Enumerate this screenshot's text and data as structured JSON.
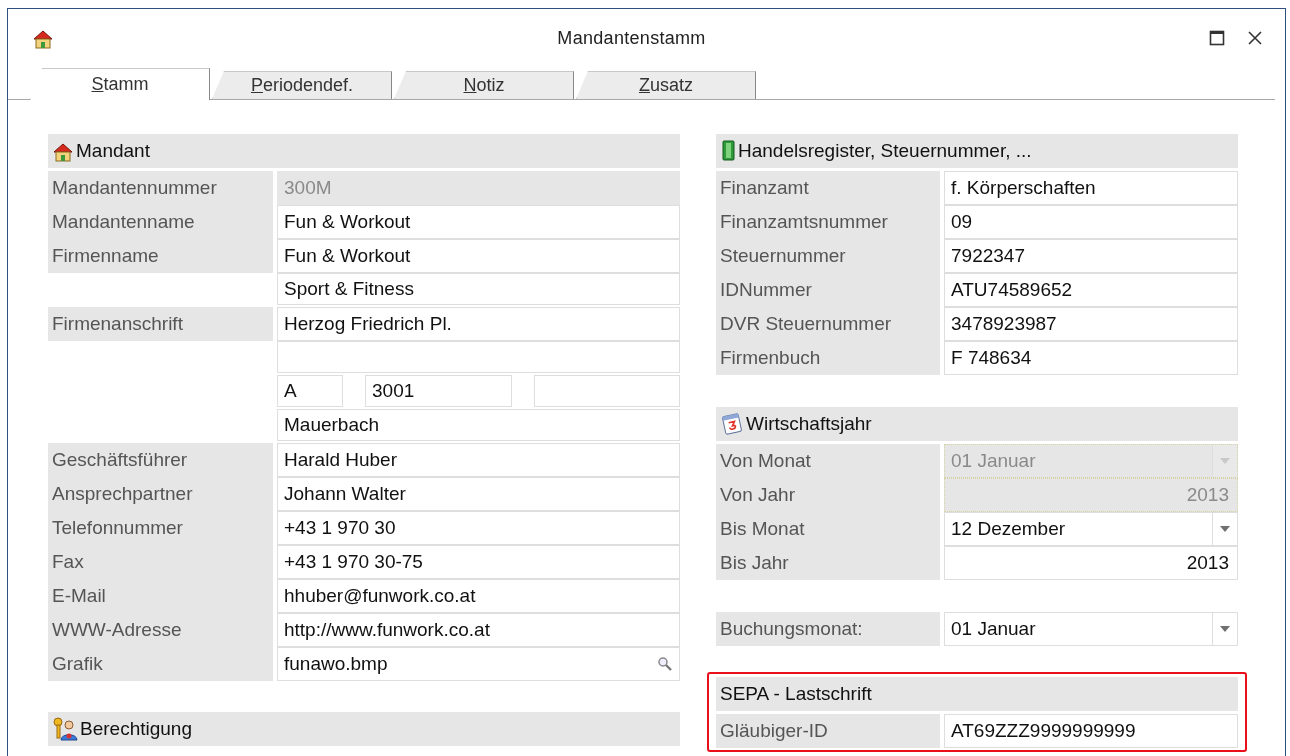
{
  "window": {
    "title": "Mandantenstamm"
  },
  "tabs": [
    {
      "label": "Stamm",
      "selected": true
    },
    {
      "label": "Periodendef.",
      "selected": false
    },
    {
      "label": "Notiz",
      "selected": false
    },
    {
      "label": "Zusatz",
      "selected": false
    }
  ],
  "columns": [
    {
      "sections": [
        {
          "title": "Mandant",
          "rows": [
            {
              "label": "Mandantennummer",
              "kind": "text",
              "value": "300M",
              "disabled": true
            },
            {
              "label": "Mandantenname",
              "kind": "text",
              "value": "Fun & Workout",
              "disabled": false
            },
            {
              "label": "Firmenname",
              "kind": "text",
              "value": "Fun & Workout",
              "disabled": false
            },
            {
              "kind": "text",
              "value": "Sport & Fitness",
              "disabled": false
            },
            {
              "label": "Firmenanschrift",
              "kind": "text",
              "value": "Herzog Friedrich Pl.",
              "disabled": false
            },
            {
              "kind": "text",
              "disabled": false
            },
            {
              "kind": "split",
              "parts": [
                {
                  "kind": "text",
                  "value": "A"
                },
                {
                  "kind": "text",
                  "value": "3001"
                },
                {
                  "kind": "text"
                }
              ],
              "disabled": false
            },
            {
              "kind": "text",
              "value": "Mauerbach",
              "disabled": false
            },
            {
              "label": "Geschäftsführer",
              "kind": "text",
              "value": "Harald Huber",
              "disabled": false
            },
            {
              "label": "Ansprechpartner",
              "kind": "text",
              "value": "Johann Walter",
              "disabled": false
            },
            {
              "label": "Telefonnummer",
              "kind": "text",
              "value": "+43 1 970 30",
              "disabled": false
            },
            {
              "label": "Fax",
              "kind": "text",
              "value": "+43 1 970 30-75",
              "disabled": false
            },
            {
              "label": "E-Mail",
              "kind": "text",
              "value": "hhuber@funwork.co.at",
              "disabled": false
            },
            {
              "label": "WWW-Adresse",
              "kind": "text",
              "value": "http://www.funwork.co.at",
              "disabled": false
            },
            {
              "label": "Grafik",
              "kind": "lookup",
              "value": "funawo.bmp",
              "disabled": false
            }
          ]
        },
        {
          "title": "Berechtigung"
        }
      ]
    },
    {
      "sections": [
        {
          "title": "Handelsregister, Steuernummer, ...",
          "rows": [
            {
              "label": "Finanzamt",
              "kind": "text",
              "value": "f. Körperschaften",
              "disabled": false
            },
            {
              "label": "Finanzamtsnummer",
              "kind": "text",
              "value": "09",
              "disabled": false
            },
            {
              "label": "Steuernummer",
              "kind": "text",
              "value": "7922347",
              "disabled": false
            },
            {
              "label": "IDNummer",
              "kind": "text",
              "value": "ATU74589652",
              "disabled": false
            },
            {
              "label": "DVR Steuernummer",
              "kind": "text",
              "value": "3478923987",
              "disabled": false
            },
            {
              "label": "Firmenbuch",
              "kind": "text",
              "value": "F 748634",
              "disabled": false
            }
          ]
        },
        {
          "title": "Wirtschaftsjahr",
          "rows": [
            {
              "label": "Von Monat",
              "kind": "combo",
              "value": "01  Januar",
              "disabled": true
            },
            {
              "label": "Von Jahr",
              "kind": "number",
              "value": "2013",
              "disabled": true
            },
            {
              "label": "Bis Monat",
              "kind": "combo",
              "value": "12  Dezember",
              "disabled": false
            },
            {
              "label": "Bis Jahr",
              "kind": "number",
              "value": "2013",
              "disabled": false
            }
          ]
        },
        {
          "rows": [
            {
              "label": "Buchungsmonat:",
              "kind": "combo",
              "value": "01 Januar",
              "disabled": false
            }
          ]
        },
        {
          "title": "SEPA - Lastschrift",
          "highlighted": true,
          "rows": [
            {
              "label": "Gläubiger-ID",
              "kind": "text",
              "value": "AT69ZZZ9999999999",
              "disabled": false
            }
          ]
        }
      ]
    }
  ]
}
